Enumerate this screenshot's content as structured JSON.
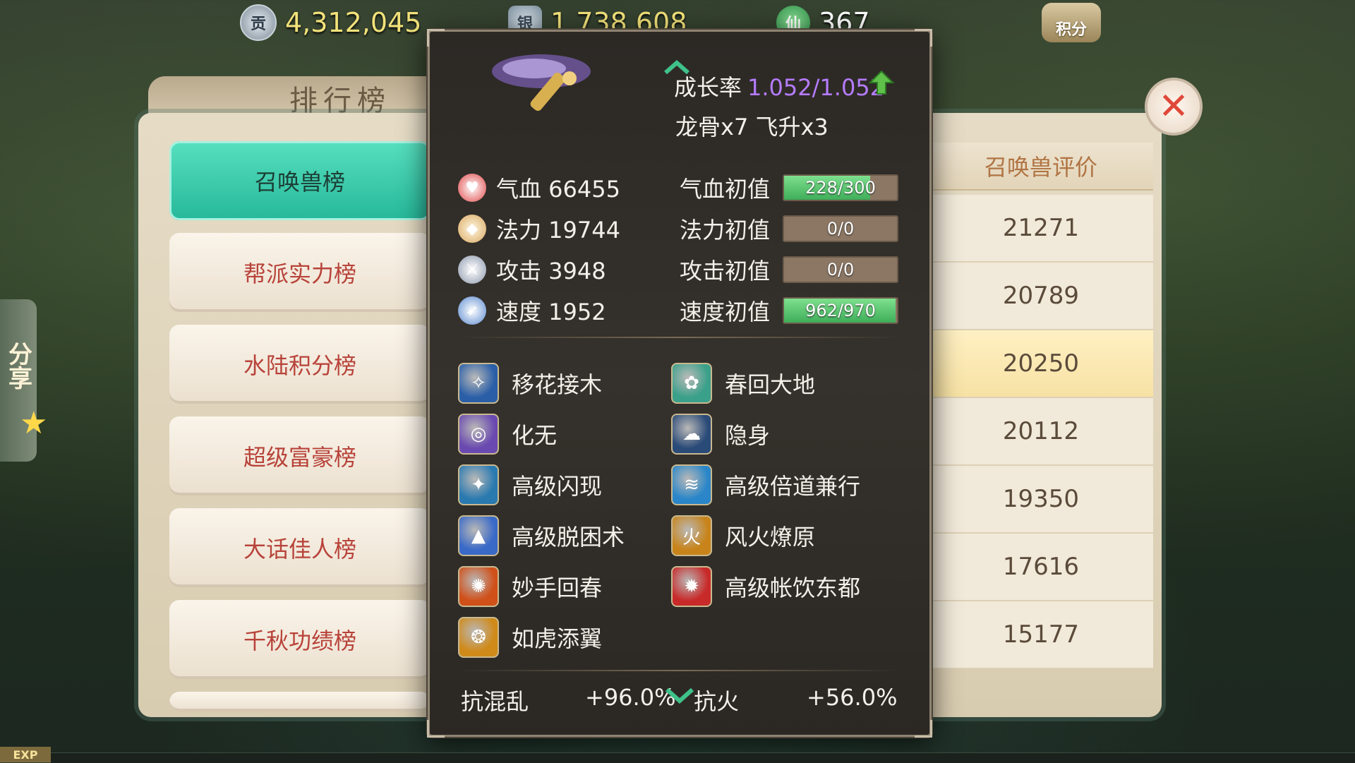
{
  "topbar": {
    "currency1": {
      "icon": "contribution-coin-icon",
      "glyph": "贡",
      "value": "4,312,045"
    },
    "currency2": {
      "icon": "silver-ingot-icon",
      "glyph": "银",
      "value": "1,738,608"
    },
    "currency3": {
      "icon": "jade-gourd-icon",
      "glyph": "仙",
      "value": "367"
    },
    "points_label": "积分"
  },
  "share_label": "分享",
  "ranking": {
    "title": "排行榜",
    "tabs": [
      {
        "label": "召唤兽榜",
        "active": true
      },
      {
        "label": "帮派实力榜"
      },
      {
        "label": "水陆积分榜"
      },
      {
        "label": "超级富豪榜"
      },
      {
        "label": "大话佳人榜"
      },
      {
        "label": "千秋功绩榜"
      }
    ],
    "eval_header": "召唤兽评价",
    "eval_values": [
      "21271",
      "20789",
      "20250",
      "20112",
      "19350",
      "17616",
      "15177"
    ],
    "highlight_index": 2
  },
  "pet_card": {
    "growth_label": "成长率",
    "growth_value": "1.052/1.052",
    "bones_text": "龙骨x7  飞升x3",
    "stats": [
      {
        "icon": "heart-icon",
        "label": "气血 66455",
        "init_label": "气血初值",
        "bar_text": "228/300",
        "fill": 0.76,
        "color": "#e04848"
      },
      {
        "icon": "mana-icon",
        "label": "法力 19744",
        "init_label": "法力初值",
        "bar_text": "0/0",
        "fill": 0,
        "color": "#e0b878"
      },
      {
        "icon": "sword-icon",
        "label": "攻击 3948",
        "init_label": "攻击初值",
        "bar_text": "0/0",
        "fill": 0,
        "color": "#9aa6b8"
      },
      {
        "icon": "speed-icon",
        "label": "速度 1952",
        "init_label": "速度初值",
        "bar_text": "962/970",
        "fill": 0.99,
        "color": "#6a9ae0"
      }
    ],
    "skills": [
      {
        "name": "移花接木",
        "icon": "yihuajiemu-skill-icon",
        "color": "#2a5fa8"
      },
      {
        "name": "春回大地",
        "icon": "chunhuidadi-skill-icon",
        "color": "#3aa08a"
      },
      {
        "name": "化无",
        "icon": "huawu-skill-icon",
        "color": "#6a4ab0"
      },
      {
        "name": "隐身",
        "icon": "yinshen-skill-icon",
        "color": "#2a4a78"
      },
      {
        "name": "高级闪现",
        "icon": "shanxian-skill-icon",
        "color": "#2a7ab0"
      },
      {
        "name": "高级倍道兼行",
        "icon": "beidaojianxing-skill-icon",
        "color": "#2a86c8"
      },
      {
        "name": "高级脱困术",
        "icon": "tuokunshu-skill-icon",
        "color": "#3a6ac8"
      },
      {
        "name": "风火燎原",
        "icon": "fenghuoliaoyuan-skill-icon",
        "color": "#c8841a",
        "glyph": "火"
      },
      {
        "name": "妙手回春",
        "icon": "miaoshouhuichun-skill-icon",
        "color": "#d0501a"
      },
      {
        "name": "高级帐饮东都",
        "icon": "zhangyindongdu-skill-icon",
        "color": "#c82a2a"
      },
      {
        "name": "如虎添翼",
        "icon": "ruhutianyi-skill-icon",
        "color": "#d08a1a"
      }
    ],
    "resist": [
      {
        "label": "抗混乱",
        "value": "+96.0%"
      },
      {
        "label": "抗火",
        "value": "+56.0%"
      }
    ]
  },
  "exp_label": "EXP"
}
